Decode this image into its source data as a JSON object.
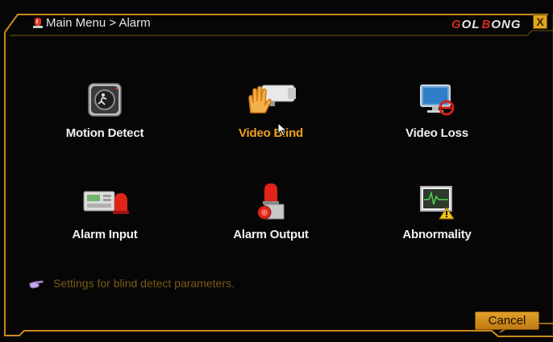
{
  "window": {
    "title": "Main Menu > Alarm",
    "brand": {
      "prefix": "",
      "part1": "OL",
      "part2": "ONG"
    }
  },
  "close_label": "X",
  "menu_items": [
    {
      "id": "motion-detect",
      "label": "Motion Detect",
      "icon": "motion-sensor-icon"
    },
    {
      "id": "video-blind",
      "label": "Video Blind",
      "icon": "hand-over-camera-icon",
      "selected": true
    },
    {
      "id": "video-loss",
      "label": "Video Loss",
      "icon": "monitor-loss-icon"
    },
    {
      "id": "alarm-input",
      "label": "Alarm Input",
      "icon": "alarm-panel-icon"
    },
    {
      "id": "alarm-output",
      "label": "Alarm Output",
      "icon": "siren-icon"
    },
    {
      "id": "abnormality",
      "label": "Abnormality",
      "icon": "monitor-warning-icon"
    }
  ],
  "hint": {
    "text": "Settings for blind detect parameters.",
    "icon": "pointing-hand-icon"
  },
  "buttons": {
    "cancel": "Cancel"
  },
  "colors": {
    "accent": "#f0a21c",
    "frame": "#c98a1a",
    "brand_red": "#d42b1f",
    "hint": "#7a5a16"
  }
}
